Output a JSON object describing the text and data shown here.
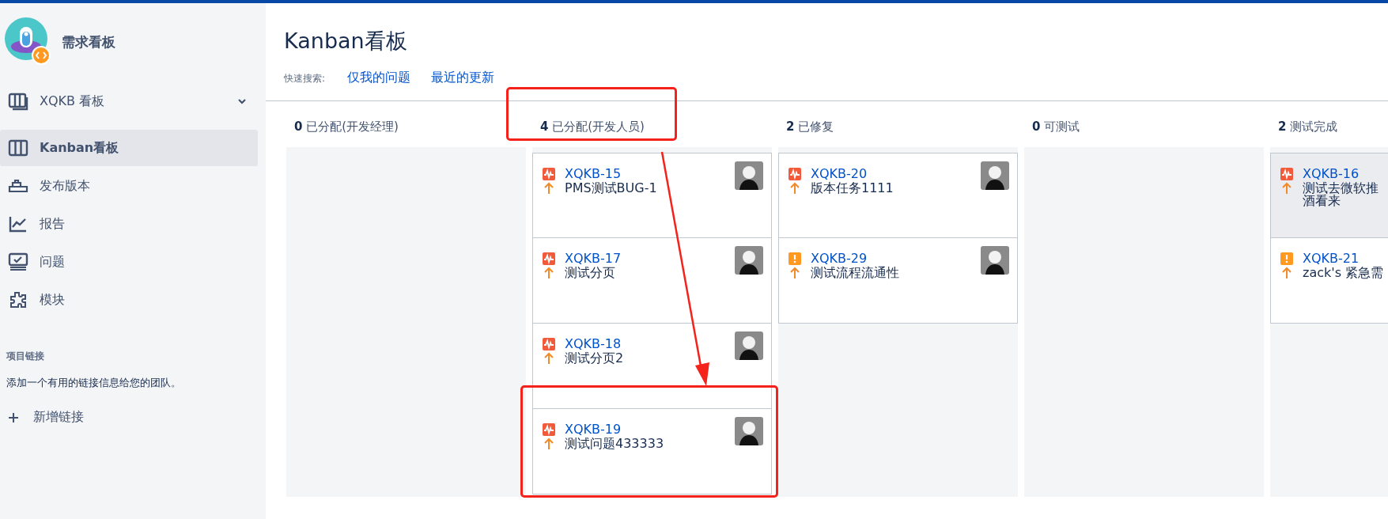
{
  "project": {
    "name": "需求看板"
  },
  "board_switcher": {
    "label": "XQKB 看板"
  },
  "nav": [
    {
      "label": "Kanban看板",
      "selected": true
    },
    {
      "label": "发布版本",
      "selected": false
    },
    {
      "label": "报告",
      "selected": false
    },
    {
      "label": "问题",
      "selected": false
    },
    {
      "label": "模块",
      "selected": false
    }
  ],
  "project_links": {
    "heading": "项目链接",
    "description": "添加一个有用的链接信息给您的团队。",
    "add_label": "新增链接"
  },
  "page_title": "Kanban看板",
  "quick_search": {
    "label": "快速搜索:",
    "filters": [
      "仅我的问题",
      "最近的更新"
    ]
  },
  "columns": [
    {
      "count": "0",
      "name": "已分配(开发经理)",
      "highlighted": false
    },
    {
      "count": "4",
      "name": "已分配(开发人员)",
      "highlighted": true,
      "cards": [
        {
          "kind": "defect",
          "key": "XQKB-15",
          "summary": "PMS测试BUG-1",
          "selected": false,
          "highlighted": false,
          "avatar": true
        },
        {
          "kind": "defect",
          "key": "XQKB-17",
          "summary": "测试分页",
          "selected": false,
          "highlighted": false,
          "avatar": true
        },
        {
          "kind": "defect",
          "key": "XQKB-18",
          "summary": "测试分页2",
          "selected": false,
          "highlighted": false,
          "avatar": true
        },
        {
          "kind": "defect",
          "key": "XQKB-19",
          "summary": "测试问题433333",
          "selected": false,
          "highlighted": true,
          "avatar": true
        }
      ]
    },
    {
      "count": "2",
      "name": "已修复",
      "highlighted": false,
      "cards": [
        {
          "kind": "defect",
          "key": "XQKB-20",
          "summary": "版本任务1111",
          "selected": false,
          "highlighted": false,
          "avatar": true
        },
        {
          "kind": "alert",
          "key": "XQKB-29",
          "summary": "测试流程流通性",
          "selected": false,
          "highlighted": false,
          "avatar": true
        }
      ]
    },
    {
      "count": "0",
      "name": "可测试",
      "highlighted": false
    },
    {
      "count": "2",
      "name": "测试完成",
      "highlighted": false,
      "cards": [
        {
          "kind": "defect",
          "key": "XQKB-16",
          "summary": "测试去微软推",
          "summary_continued": "酒看来",
          "selected": true,
          "highlighted": false
        },
        {
          "kind": "alert",
          "key": "XQKB-21",
          "summary": "zack's 紧急需",
          "selected": false,
          "highlighted": false
        }
      ]
    }
  ]
}
